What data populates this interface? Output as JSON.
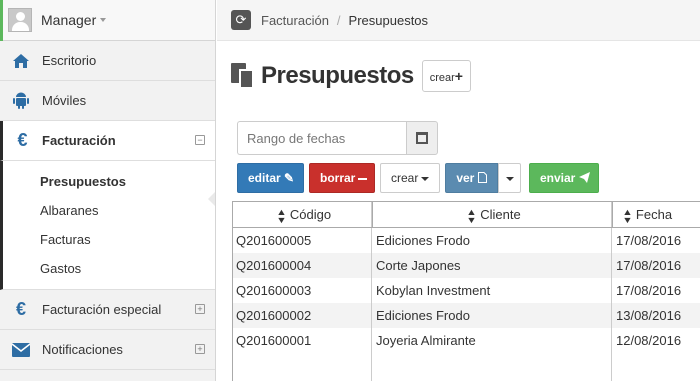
{
  "user": {
    "name": "Manager"
  },
  "sidebar": {
    "items": [
      {
        "label": "Escritorio",
        "icon": "home-icon"
      },
      {
        "label": "Móviles",
        "icon": "android-icon"
      },
      {
        "label": "Facturación",
        "icon": "euro-icon",
        "expanded": true
      },
      {
        "label": "Facturación especial",
        "icon": "euro-icon"
      },
      {
        "label": "Notificaciones",
        "icon": "envelope-icon"
      }
    ],
    "submenu": [
      "Presupuestos",
      "Albaranes",
      "Facturas",
      "Gastos"
    ],
    "current_sub": "Presupuestos"
  },
  "breadcrumb": {
    "parent": "Facturación",
    "current": "Presupuestos"
  },
  "page": {
    "title": "Presupuestos",
    "create_label": "crear"
  },
  "filter": {
    "date_placeholder": "Rango de fechas"
  },
  "toolbar": {
    "edit": "editar",
    "delete": "borrar",
    "create": "crear",
    "view": "ver",
    "send": "enviar"
  },
  "table": {
    "columns": [
      "Código",
      "Cliente",
      "Fecha"
    ],
    "rows": [
      [
        "Q201600005",
        "Ediciones Frodo",
        "17/08/2016"
      ],
      [
        "Q201600004",
        "Corte Japones",
        "17/08/2016"
      ],
      [
        "Q201600003",
        "Kobylan Investment",
        "17/08/2016"
      ],
      [
        "Q201600002",
        "Ediciones Frodo",
        "13/08/2016"
      ],
      [
        "Q201600001",
        "Joyeria Almirante",
        "12/08/2016"
      ]
    ]
  },
  "colors": {
    "primary": "#337ab7",
    "danger": "#c9302c",
    "success": "#5cb85c",
    "info": "#5b8bb0"
  }
}
